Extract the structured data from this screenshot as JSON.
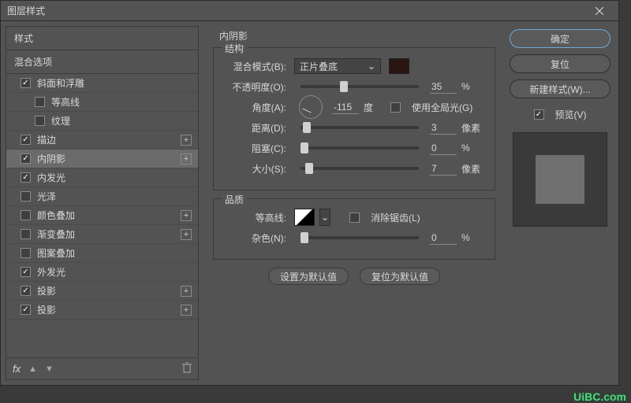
{
  "dialog": {
    "title": "图层样式"
  },
  "left": {
    "head": "样式",
    "sub": "混合选项",
    "items": [
      {
        "label": "斜面和浮雕",
        "checked": true,
        "addable": false,
        "sub": false
      },
      {
        "label": "等高线",
        "checked": false,
        "addable": false,
        "sub": true
      },
      {
        "label": "纹理",
        "checked": false,
        "addable": false,
        "sub": true
      },
      {
        "label": "描边",
        "checked": true,
        "addable": true,
        "sub": false
      },
      {
        "label": "内阴影",
        "checked": true,
        "addable": true,
        "sub": false,
        "selected": true
      },
      {
        "label": "内发光",
        "checked": true,
        "addable": false,
        "sub": false
      },
      {
        "label": "光泽",
        "checked": false,
        "addable": false,
        "sub": false
      },
      {
        "label": "颜色叠加",
        "checked": false,
        "addable": true,
        "sub": false
      },
      {
        "label": "渐变叠加",
        "checked": false,
        "addable": true,
        "sub": false
      },
      {
        "label": "图案叠加",
        "checked": false,
        "addable": false,
        "sub": false
      },
      {
        "label": "外发光",
        "checked": true,
        "addable": false,
        "sub": false
      },
      {
        "label": "投影",
        "checked": true,
        "addable": true,
        "sub": false
      },
      {
        "label": "投影",
        "checked": true,
        "addable": true,
        "sub": false
      }
    ],
    "fx": "fx"
  },
  "mid": {
    "title": "内阴影",
    "structure": {
      "title": "结构",
      "blendMode": {
        "label": "混合模式(B):",
        "value": "正片叠底"
      },
      "opacity": {
        "label": "不透明度(O):",
        "value": "35",
        "unit": "%",
        "pos": 33
      },
      "angle": {
        "label": "角度(A):",
        "value": "-115",
        "unit": "度"
      },
      "useGlobal": {
        "label": "使用全局光(G)",
        "checked": false
      },
      "distance": {
        "label": "距离(D):",
        "value": "3",
        "unit": "像素",
        "pos": 2
      },
      "choke": {
        "label": "阻塞(C):",
        "value": "0",
        "unit": "%",
        "pos": 0
      },
      "size": {
        "label": "大小(S):",
        "value": "7",
        "unit": "像素",
        "pos": 4
      }
    },
    "quality": {
      "title": "品质",
      "contour": {
        "label": "等高线:"
      },
      "antialias": {
        "label": "消除锯齿(L)",
        "checked": false
      },
      "noise": {
        "label": "杂色(N):",
        "value": "0",
        "unit": "%",
        "pos": 0
      }
    },
    "btns": {
      "default": "设置为默认值",
      "reset": "复位为默认值"
    }
  },
  "right": {
    "ok": "确定",
    "cancel": "复位",
    "newStyle": "新建样式(W)...",
    "preview": {
      "label": "预览(V)",
      "checked": true
    }
  },
  "watermark": "UiBC.com"
}
